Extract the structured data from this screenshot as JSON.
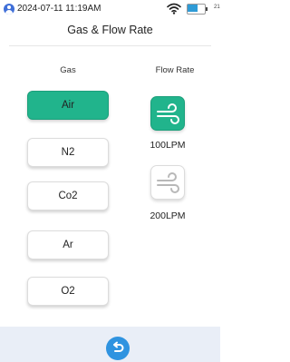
{
  "status_bar": {
    "time": "2024-07-11 11:19AM",
    "extra": "21",
    "battery_level_pct": 60,
    "battery_color": "#2f9bd6"
  },
  "page": {
    "title": "Gas & Flow Rate"
  },
  "gas": {
    "header": "Gas",
    "options": [
      "Air",
      "N2",
      "Co2",
      "Ar",
      "O2"
    ],
    "selected": "Air"
  },
  "flow_rate": {
    "header": "Flow Rate",
    "options": [
      {
        "label": "100LPM",
        "icon": "wind-icon",
        "selected": true
      },
      {
        "label": "200LPM",
        "icon": "wind-icon",
        "selected": false
      }
    ]
  },
  "colors": {
    "accent": "#21b48c",
    "back_button": "#2f93e0",
    "bottom_bar": "#e9eef7"
  },
  "back_icon": "undo-arrow-icon"
}
